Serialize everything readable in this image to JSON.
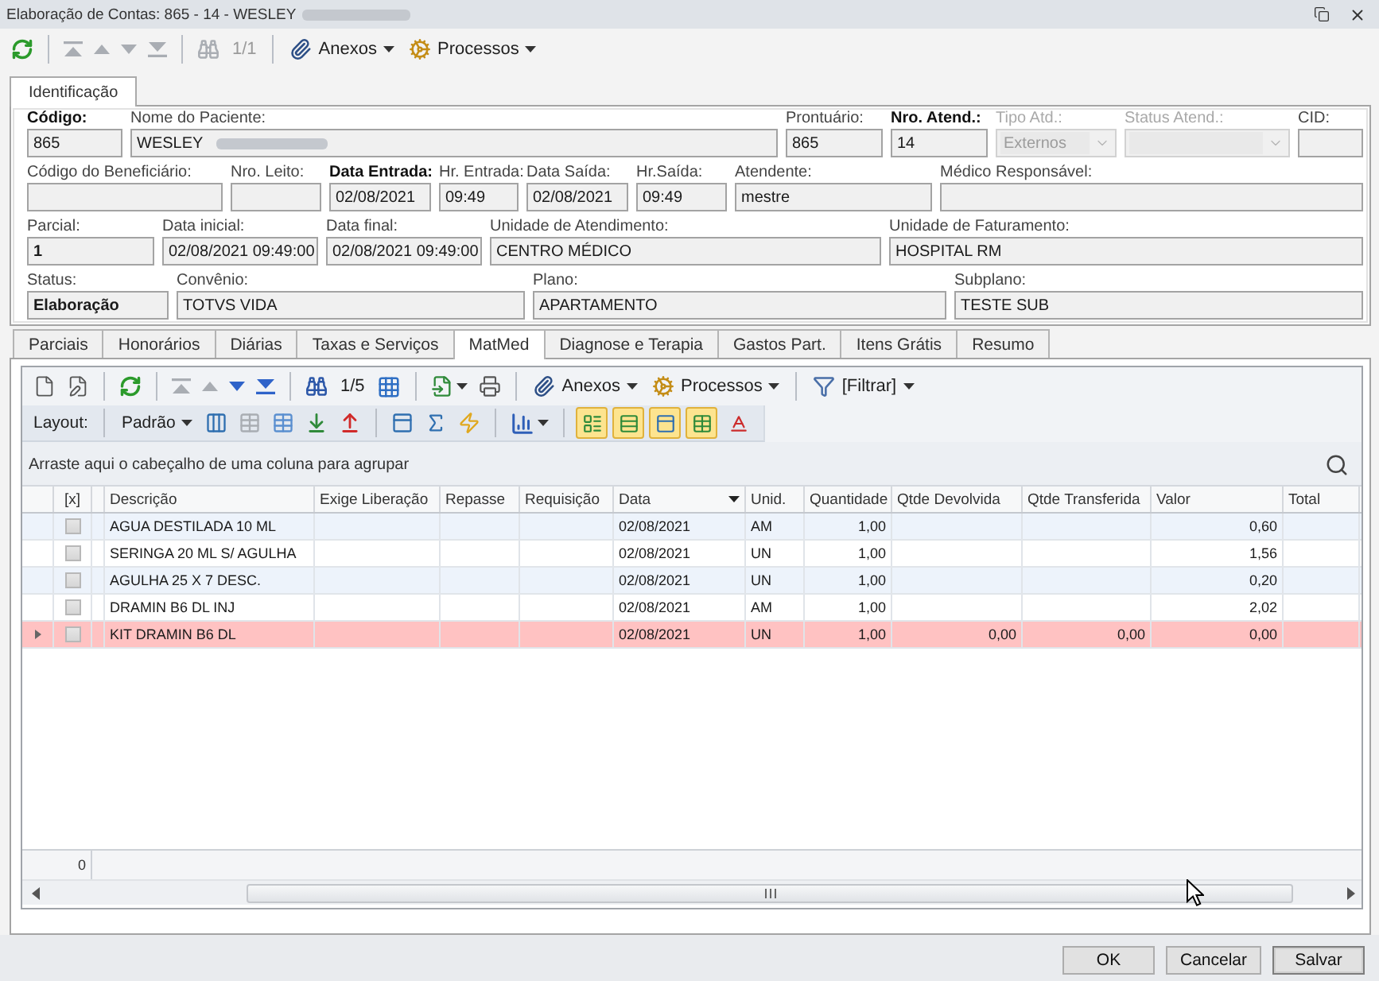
{
  "window": {
    "title": "Elaboração de Contas: 865 - 14 - WESLEY",
    "title_redacted": true
  },
  "toolbar": {
    "navigation": [
      {
        "disabled": true
      },
      {
        "disabled": true
      },
      {
        "disabled": true
      },
      {
        "disabled": true
      }
    ],
    "counter": {
      "text": "1/1",
      "disabled": true
    },
    "menus": [
      {
        "label": "Anexos"
      },
      {
        "label": "Processos"
      }
    ]
  },
  "form_tabs": [
    {
      "label": "Identificação",
      "selected": true
    }
  ],
  "identification": {
    "rows": [
      [
        {
          "label": "Código:",
          "label_bold": true,
          "value": "865",
          "kind": "text",
          "disabled": false,
          "redacted": false
        },
        {
          "label": "Nome do Paciente:",
          "label_bold": false,
          "value": "WESLEY",
          "kind": "text",
          "disabled": false,
          "redacted": true
        },
        {
          "label": "Prontuário:",
          "label_bold": false,
          "value": "865",
          "kind": "text",
          "disabled": false,
          "redacted": false
        },
        {
          "label": "Nro. Atend.:",
          "label_bold": true,
          "value": "14",
          "kind": "text",
          "disabled": false,
          "redacted": false
        },
        {
          "label": "Tipo Atd.:",
          "label_bold": false,
          "value": "Externos",
          "kind": "combo",
          "disabled": true,
          "redacted": false
        },
        {
          "label": "Status Atend.:",
          "label_bold": false,
          "kind": "combo",
          "disabled": true,
          "redacted": false
        },
        {
          "label": "CID:",
          "label_bold": false,
          "kind": "text",
          "disabled": false,
          "redacted": false
        }
      ],
      [
        {
          "label": "Código do Beneficiário:",
          "label_bold": false,
          "kind": "text",
          "disabled": false,
          "redacted": false
        },
        {
          "label": "Nro. Leito:",
          "label_bold": false,
          "kind": "text",
          "disabled": false,
          "redacted": false
        },
        {
          "label": "Data Entrada:",
          "label_bold": true,
          "value": "02/08/2021",
          "kind": "text",
          "disabled": false,
          "redacted": false
        },
        {
          "label": "Hr. Entrada:",
          "label_bold": false,
          "value": "09:49",
          "kind": "text",
          "disabled": false,
          "redacted": false
        },
        {
          "label": "Data Saída:",
          "label_bold": false,
          "value": "02/08/2021",
          "kind": "text",
          "disabled": false,
          "redacted": false
        },
        {
          "label": "Hr.Saída:",
          "label_bold": false,
          "value": "09:49",
          "kind": "text",
          "disabled": false,
          "redacted": false
        },
        {
          "label": "Atendente:",
          "label_bold": false,
          "value": "mestre",
          "kind": "text",
          "disabled": false,
          "redacted": false
        },
        {
          "label": "Médico Responsável:",
          "label_bold": false,
          "kind": "text",
          "disabled": false,
          "redacted": false
        }
      ],
      [
        {
          "label": "Parcial:",
          "label_bold": false,
          "value": "1",
          "kind": "text",
          "disabled": false,
          "redacted": false
        },
        {
          "label": "Data inicial:",
          "label_bold": false,
          "value": "02/08/2021 09:49:00",
          "kind": "text",
          "disabled": false,
          "redacted": false
        },
        {
          "label": "Data final:",
          "label_bold": false,
          "value": "02/08/2021 09:49:00",
          "kind": "text",
          "disabled": false,
          "redacted": false
        },
        {
          "label": "Unidade de Atendimento:",
          "label_bold": false,
          "value": "CENTRO MÉDICO",
          "kind": "text",
          "disabled": false,
          "redacted": false
        },
        {
          "label": "Unidade de Faturamento:",
          "label_bold": false,
          "value": "HOSPITAL RM",
          "kind": "text",
          "disabled": false,
          "redacted": false
        }
      ],
      [
        {
          "label": "Status:",
          "label_bold": false,
          "value": "Elaboração",
          "kind": "text",
          "disabled": false,
          "redacted": false
        },
        {
          "label": "Convênio:",
          "label_bold": false,
          "value": "TOTVS VIDA",
          "kind": "text",
          "disabled": false,
          "redacted": false
        },
        {
          "label": "Plano:",
          "label_bold": false,
          "value": "APARTAMENTO",
          "kind": "text",
          "disabled": false,
          "redacted": false
        },
        {
          "label": "Subplano:",
          "label_bold": false,
          "value": "TESTE SUB",
          "kind": "text",
          "disabled": false,
          "redacted": false
        }
      ]
    ]
  },
  "detail_tabs": [
    {
      "label": "Parciais",
      "selected": false
    },
    {
      "label": "Honorários",
      "selected": false
    },
    {
      "label": "Diárias",
      "selected": false
    },
    {
      "label": "Taxas e Serviços",
      "selected": false
    },
    {
      "label": "MatMed",
      "selected": true
    },
    {
      "label": "Diagnose e Terapia",
      "selected": false
    },
    {
      "label": "Gastos Part.",
      "selected": false
    },
    {
      "label": "Itens Grátis",
      "selected": false
    },
    {
      "label": "Resumo",
      "selected": false
    }
  ],
  "grid_toolbar": {
    "navigation": [
      {
        "disabled": true
      },
      {
        "disabled": true
      },
      {
        "disabled": false
      },
      {
        "disabled": false
      }
    ],
    "counter": {
      "text": "1/5",
      "disabled": false
    },
    "menus": [
      {
        "label": "Anexos"
      },
      {
        "label": "Processos"
      },
      {
        "label": "[Filtrar]"
      }
    ]
  },
  "layout_bar": {
    "label": "Layout:",
    "preset": "Padrão",
    "toggles": [
      {
        "on": true
      },
      {
        "on": true
      },
      {
        "on": true
      },
      {
        "on": true
      },
      {
        "on": false
      }
    ]
  },
  "group_panel": {
    "hint": "Arraste aqui o cabeçalho de uma coluna para agrupar"
  },
  "table": {
    "columns": [
      {
        "label": "[x]",
        "menu": false
      },
      {
        "label": "Descrição",
        "menu": false
      },
      {
        "label": "Exige Liberação",
        "menu": false
      },
      {
        "label": "Repasse",
        "menu": false
      },
      {
        "label": "Requisição",
        "menu": false
      },
      {
        "label": "Data",
        "menu": true
      },
      {
        "label": "Unid.",
        "menu": false
      },
      {
        "label": "Quantidade",
        "menu": false
      },
      {
        "label": "Qtde Devolvida",
        "menu": false
      },
      {
        "label": "Qtde Transferida",
        "menu": false
      },
      {
        "label": "Valor",
        "menu": false
      },
      {
        "label": "Total",
        "menu": false
      }
    ],
    "rows": [
      {
        "selected": false,
        "checked": false,
        "cells": {
          "description": "AGUA DESTILADA 10 ML",
          "date": "02/08/2021",
          "unit": "AM",
          "quantity": "1,00",
          "value": "0,60"
        }
      },
      {
        "selected": false,
        "checked": false,
        "cells": {
          "description": "SERINGA 20 ML S/ AGULHA",
          "date": "02/08/2021",
          "unit": "UN",
          "quantity": "1,00",
          "value": "1,56"
        }
      },
      {
        "selected": false,
        "checked": false,
        "cells": {
          "description": "AGULHA 25 X 7 DESC.",
          "date": "02/08/2021",
          "unit": "UN",
          "quantity": "1,00",
          "value": "0,20"
        }
      },
      {
        "selected": false,
        "checked": false,
        "cells": {
          "description": "DRAMIN B6 DL INJ",
          "date": "02/08/2021",
          "unit": "AM",
          "quantity": "1,00",
          "value": "2,02"
        }
      },
      {
        "selected": true,
        "checked": false,
        "cells": {
          "description": "KIT DRAMIN B6 DL",
          "date": "02/08/2021",
          "unit": "UN",
          "quantity": "1,00",
          "returned_qty": "0,00",
          "transferred_qty": "0,00",
          "value": "0,00"
        }
      }
    ],
    "footer": {
      "count": "0"
    }
  },
  "buttons": [
    {
      "label": "OK",
      "default": false
    },
    {
      "label": "Cancelar",
      "default": false
    },
    {
      "label": "Salvar",
      "default": true
    }
  ]
}
